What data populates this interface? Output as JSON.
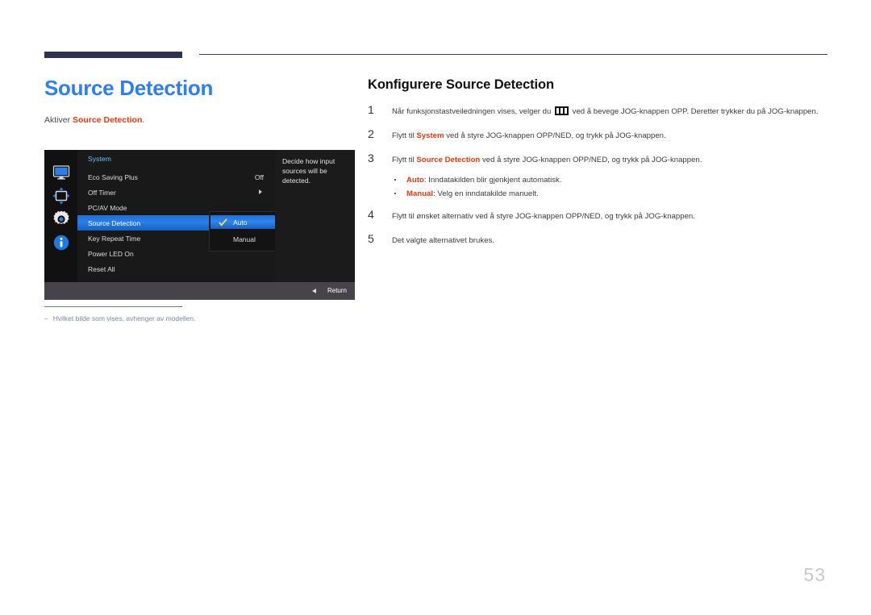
{
  "page": {
    "number": "53"
  },
  "left": {
    "title": "Source Detection",
    "intro_prefix": "Aktiver ",
    "intro_highlight": "Source Detection",
    "intro_suffix": ".",
    "footnote_dash": "‒",
    "footnote": "Hvilket bilde som vises, avhenger av modellen."
  },
  "osd": {
    "panel_title": "System",
    "icons": [
      {
        "name": "display-icon"
      },
      {
        "name": "picture-adjust-icon"
      },
      {
        "name": "system-gear-icon"
      },
      {
        "name": "information-icon"
      }
    ],
    "rows": [
      {
        "label": "Eco Saving Plus",
        "value": "Off",
        "arrow": false,
        "selected": false
      },
      {
        "label": "Off Timer",
        "value": "",
        "arrow": true,
        "selected": false
      },
      {
        "label": "PC/AV Mode",
        "value": "",
        "arrow": false,
        "selected": false
      },
      {
        "label": "Source Detection",
        "value": "",
        "arrow": false,
        "selected": true
      },
      {
        "label": "Key Repeat Time",
        "value": "",
        "arrow": false,
        "selected": false
      },
      {
        "label": "Power LED On",
        "value": "",
        "arrow": false,
        "selected": false
      },
      {
        "label": "Reset All",
        "value": "",
        "arrow": false,
        "selected": false
      }
    ],
    "submenu": [
      {
        "label": "Auto",
        "selected": true,
        "checked": true
      },
      {
        "label": "Manual",
        "selected": false,
        "checked": false
      }
    ],
    "description": "Decide how input sources will be detected.",
    "return_label": "Return",
    "colors": {
      "highlight_blue": "#2a7fe8",
      "title_cyan": "#63c8e8",
      "check_yellow": "#f5e23c",
      "background": "#131313",
      "bottom_bar": "#47434a"
    }
  },
  "right": {
    "heading": "Konfigurere Source Detection",
    "steps": [
      {
        "num": "1",
        "pre": "Når funksjonstastveiledningen vises, velger du ",
        "icon": "function-key-guide-icon",
        "post": " ved å bevege JOG-knappen OPP. Deretter trykker du på JOG-knappen.",
        "highlight": ""
      },
      {
        "num": "2",
        "pre": "Flytt til ",
        "highlight": "System",
        "post": " ved å styre JOG-knappen OPP/NED, og trykk på JOG-knappen."
      },
      {
        "num": "3",
        "pre": "Flytt til ",
        "highlight": "Source Detection",
        "post": " ved å styre JOG-knappen OPP/NED, og trykk på JOG-knappen."
      },
      {
        "num": "4",
        "pre": "Flytt til ønsket alternativ ved å styre JOG-knappen OPP/NED, og trykk på JOG-knappen.",
        "highlight": "",
        "post": ""
      },
      {
        "num": "5",
        "pre": "Det valgte alternativet brukes.",
        "highlight": "",
        "post": ""
      }
    ],
    "bullets": [
      {
        "highlight": "Auto",
        "text": ": Inndatakilden blir gjenkjent automatisk."
      },
      {
        "highlight": "Manual",
        "text": ": Velg en inndatakilde manuelt."
      }
    ]
  },
  "theme": {
    "accent_blue": "#2f7ef0",
    "accent_red": "#e8380d",
    "rule_navy": "#2e3352"
  }
}
